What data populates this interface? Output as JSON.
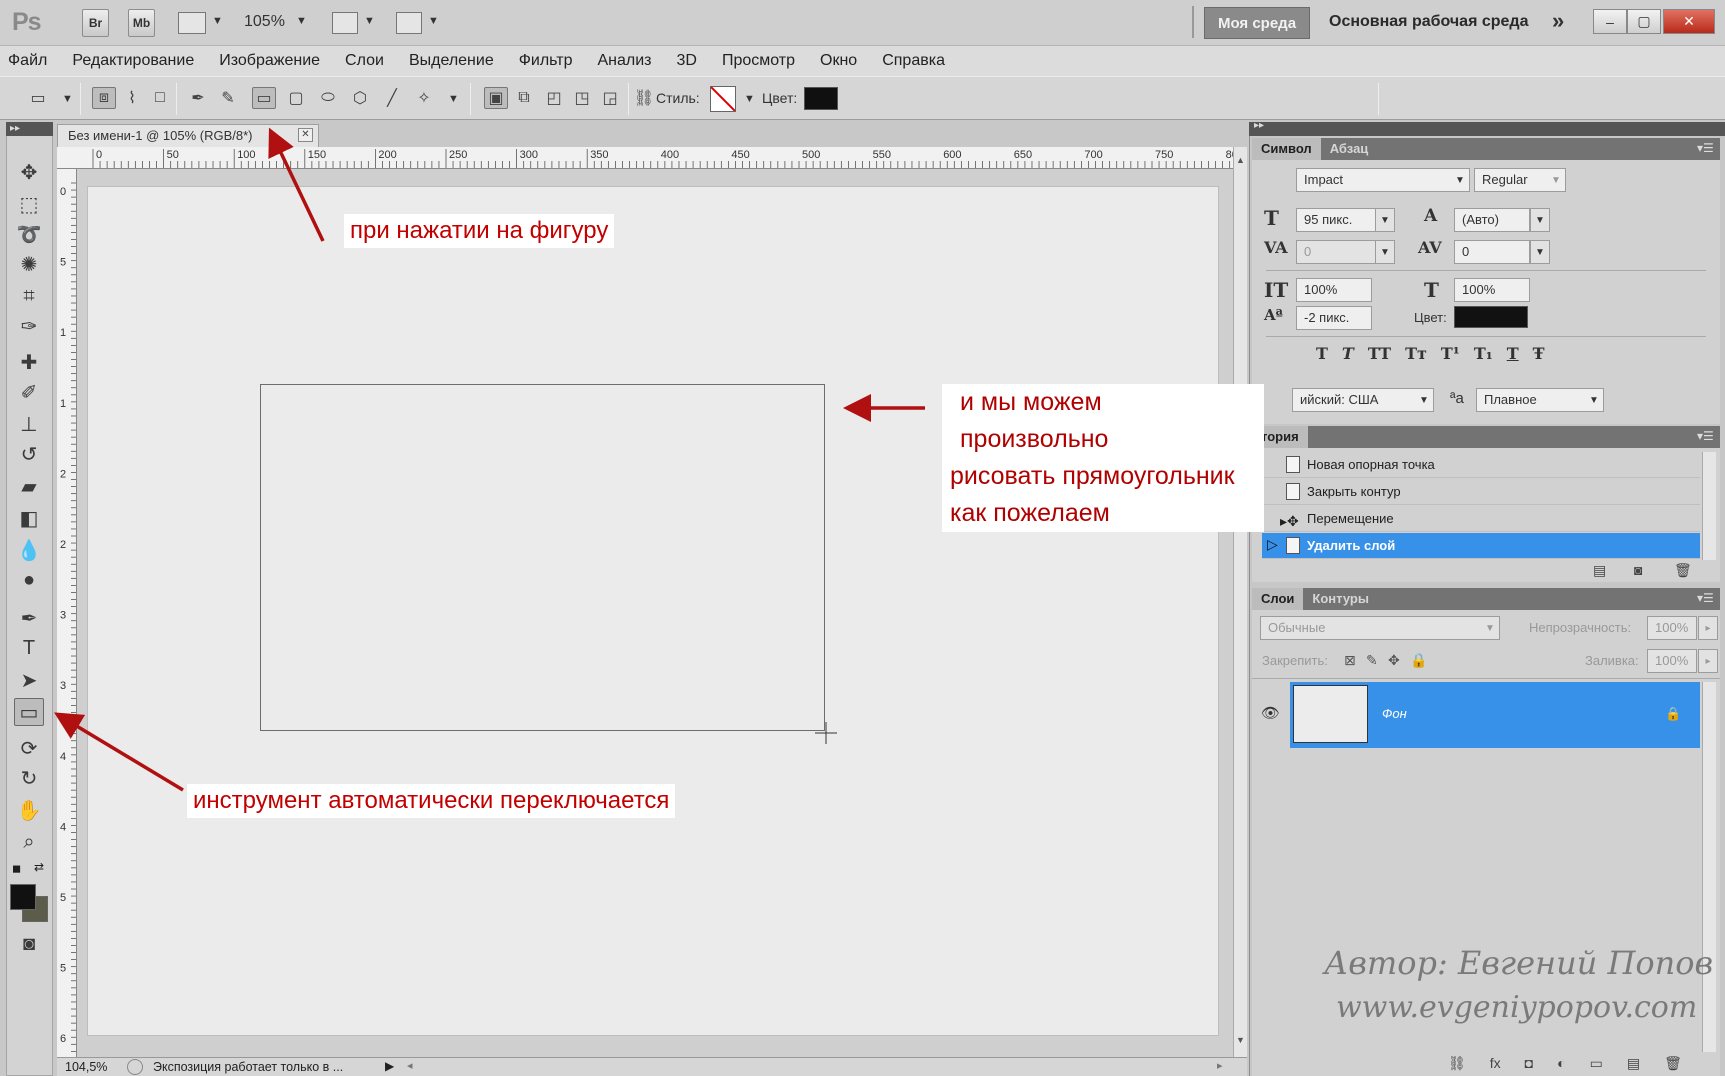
{
  "app": {
    "logo": "Ps",
    "zoom": "105%",
    "btn_br": "Br",
    "btn_mb": "Mb"
  },
  "workspace": {
    "active": "Моя среда",
    "main": "Основная рабочая среда",
    "more": "»"
  },
  "window_buttons": {
    "minimize": "–",
    "restore": "▢",
    "close": "✕"
  },
  "menu": [
    "Файл",
    "Редактирование",
    "Изображение",
    "Слои",
    "Выделение",
    "Фильтр",
    "Анализ",
    "3D",
    "Просмотр",
    "Окно",
    "Справка"
  ],
  "options": {
    "style_label": "Стиль:",
    "color_label": "Цвет:"
  },
  "document": {
    "tab_title": "Без имени-1 @ 105% (RGB/8*)",
    "ruler_marks": [
      "0",
      "50",
      "100",
      "150",
      "200",
      "250",
      "300",
      "350",
      "400",
      "450",
      "500",
      "550",
      "600",
      "650",
      "700",
      "750",
      "80"
    ],
    "ruler_left_marks": [
      "0",
      "5",
      "1",
      "1",
      "2",
      "2",
      "3",
      "3",
      "4",
      "4",
      "5",
      "5",
      "6"
    ]
  },
  "status": {
    "zoom": "104,5%",
    "message": "Экспозиция работает только в ..."
  },
  "character_panel": {
    "tabs": [
      "Символ",
      "Абзац"
    ],
    "font_family": "Impact",
    "font_style": "Regular",
    "size": "95 пикс.",
    "leading": "(Авто)",
    "kerning": "0",
    "tracking": "0",
    "vscale": "100%",
    "hscale": "100%",
    "baseline": "-2 пикс.",
    "color_label": "Цвет:",
    "typo_buttons": [
      "T",
      "T",
      "TT",
      "Tт",
      "T¹",
      "T₁",
      "T",
      "Ŧ"
    ],
    "language": "ийский: США",
    "aa_icon": "ªa",
    "antialias": "Плавное"
  },
  "history_panel": {
    "tab": "тория",
    "items": [
      "Новая опорная точка",
      "Закрыть контур",
      "Перемещение",
      "Удалить слой"
    ]
  },
  "layers_panel": {
    "tabs": [
      "Слои",
      "Контуры"
    ],
    "blend_mode": "Обычные",
    "opacity_label": "Непрозрачность:",
    "opacity": "100%",
    "lock_label": "Закрепить:",
    "fill_label": "Заливка:",
    "fill": "100%",
    "layer_name": "Фон"
  },
  "annotations": {
    "shape_click": "при нажатии на фигуру",
    "tool_switch": "инструмент автоматически переключается",
    "free_draw": [
      "и мы можем произвольно",
      "рисовать прямоугольник",
      "как пожелаем"
    ]
  },
  "watermark": {
    "author": "Автор:  Евгений  Попов",
    "site": "www.evgeniypopov.com"
  },
  "colors": {
    "accent_blue": "#3791e8",
    "annotation_red": "#c20000",
    "arrow_red": "#b01010"
  }
}
